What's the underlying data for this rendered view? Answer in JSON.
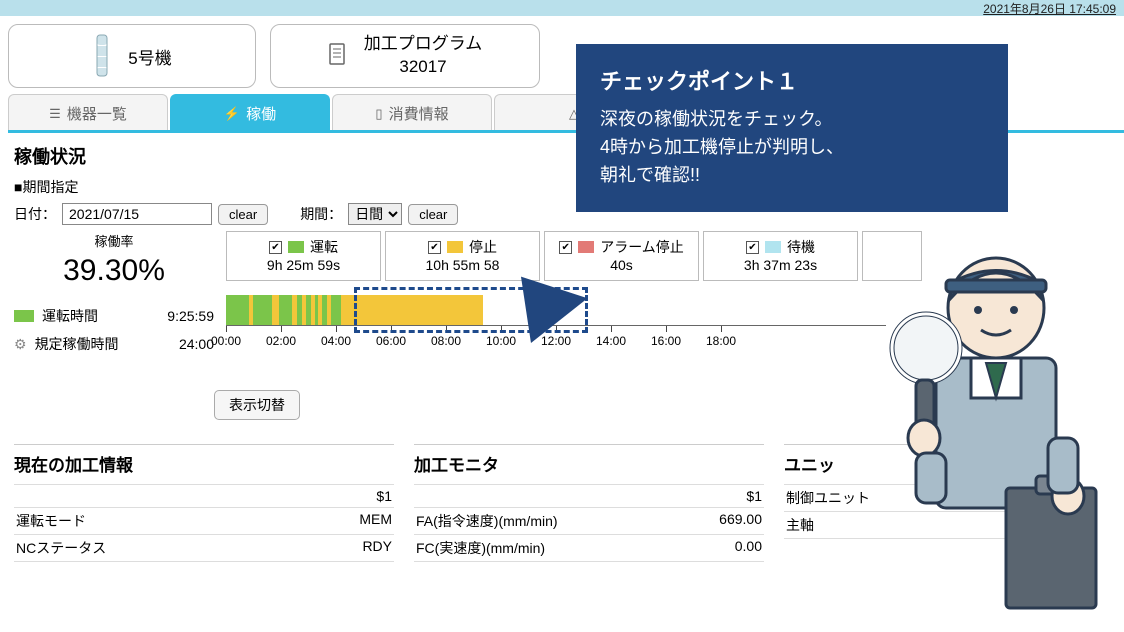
{
  "timestamp": "2021年8月26日 17:45:09",
  "header": {
    "machine": "5号機",
    "program_label": "加工プログラム",
    "program_no": "32017"
  },
  "tabs": {
    "list": "機器一覧",
    "oper": "稼働",
    "consume": "消費情報"
  },
  "status": {
    "title": "稼働状況",
    "period_label": "■期間指定",
    "date_label": "日付：",
    "date_value": "2021/07/15",
    "clear": "clear",
    "period": "期間：",
    "interval": "日間",
    "rate_label": "稼働率",
    "rate_value": "39.30%",
    "run_time_label": "運転時間",
    "run_time_value": "9:25:59",
    "std_time_label": "規定稼働時間",
    "std_time_value": "24:00",
    "toggle": "表示切替"
  },
  "legend": {
    "run": {
      "label": "運転",
      "time": "9h 25m 59s"
    },
    "stop": {
      "label": "停止",
      "time": "10h 55m 58"
    },
    "alarm": {
      "label": "アラーム停止",
      "time": "40s"
    },
    "wait": {
      "label": "待機",
      "time": "3h 37m 23s"
    }
  },
  "chart_data": {
    "type": "bar",
    "orientation": "horizontal-timeline",
    "xlabel": "time",
    "xlim": [
      "00:00",
      "24:00"
    ],
    "ticks": [
      "00:00",
      "02:00",
      "04:00",
      "06:00",
      "08:00",
      "10:00",
      "12:00",
      "14:00",
      "16:00",
      "18:00"
    ],
    "segments": [
      {
        "state": "run",
        "from": "00:00",
        "to": "00:50"
      },
      {
        "state": "stop",
        "from": "00:50",
        "to": "01:00"
      },
      {
        "state": "run",
        "from": "01:00",
        "to": "01:40"
      },
      {
        "state": "stop",
        "from": "01:40",
        "to": "01:55"
      },
      {
        "state": "run",
        "from": "01:55",
        "to": "02:25"
      },
      {
        "state": "stop",
        "from": "02:25",
        "to": "02:35"
      },
      {
        "state": "run",
        "from": "02:35",
        "to": "02:45"
      },
      {
        "state": "stop",
        "from": "02:45",
        "to": "02:55"
      },
      {
        "state": "run",
        "from": "02:55",
        "to": "03:05"
      },
      {
        "state": "stop",
        "from": "03:05",
        "to": "03:15"
      },
      {
        "state": "run",
        "from": "03:15",
        "to": "03:20"
      },
      {
        "state": "stop",
        "from": "03:20",
        "to": "03:30"
      },
      {
        "state": "run",
        "from": "03:30",
        "to": "03:40"
      },
      {
        "state": "stop",
        "from": "03:40",
        "to": "03:50"
      },
      {
        "state": "run",
        "from": "03:50",
        "to": "04:10"
      },
      {
        "state": "stop",
        "from": "04:10",
        "to": "09:20"
      }
    ],
    "highlight": {
      "from": "03:50",
      "to": "09:20"
    }
  },
  "callout": {
    "title": "チェックポイント１",
    "line1": "深夜の稼働状況をチェック。",
    "line2": "4時から加工機停止が判明し、",
    "line3": "朝礼で確認!!"
  },
  "panel1": {
    "title": "現在の加工情報",
    "head": "$1",
    "rows": [
      {
        "k": "運転モード",
        "v": "MEM"
      },
      {
        "k": "NCステータス",
        "v": "RDY"
      }
    ]
  },
  "panel2": {
    "title": "加工モニタ",
    "head": "$1",
    "rows": [
      {
        "k": "FA(指令速度)(mm/min)",
        "v": "669.00"
      },
      {
        "k": "FC(実速度)(mm/min)",
        "v": "0.00"
      }
    ]
  },
  "panel3": {
    "title": "ユニッ",
    "rows": [
      {
        "k": "制御ユニット",
        "v": ""
      },
      {
        "k": "主軸",
        "v": ""
      }
    ]
  }
}
